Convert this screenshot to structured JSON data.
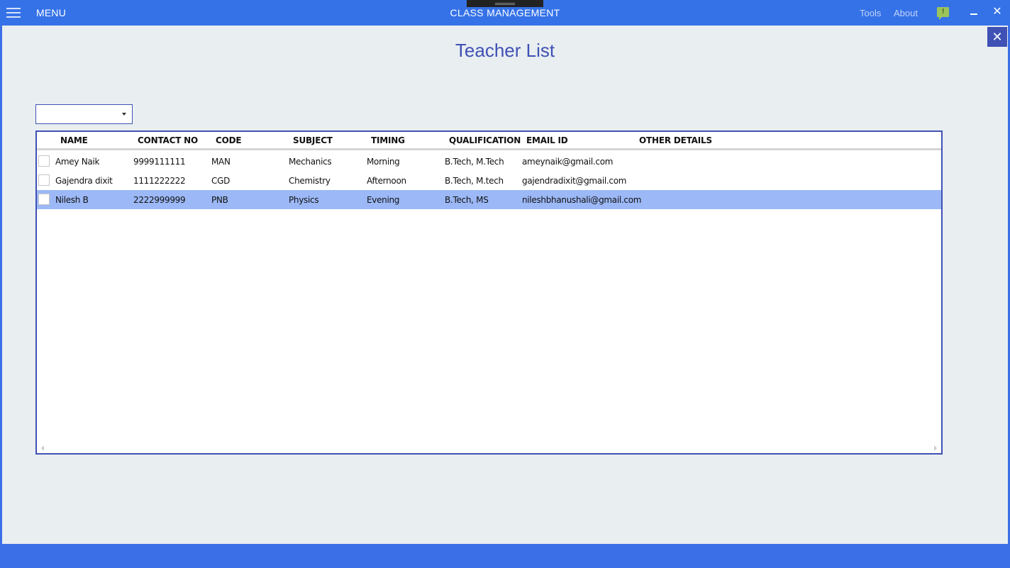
{
  "titlebar": {
    "menu_label": "MENU",
    "app_title": "CLASS MANAGEMENT",
    "tools_label": "Tools",
    "about_label": "About",
    "feedback_glyph": "!",
    "close_glyph": "✕",
    "accent_color": "#3572e8",
    "icons": [
      "hamburger-menu-icon",
      "feedback-icon",
      "minimize-icon",
      "close-icon"
    ]
  },
  "page": {
    "title": "Teacher List",
    "close_glyph": "✕",
    "title_color": "#3f51b5"
  },
  "filter": {
    "selected_value": ""
  },
  "grid": {
    "columns": [
      "NAME",
      "CONTACT NO",
      "CODE",
      "SUBJECT",
      "TIMING",
      "QUALIFICATION",
      "EMAIL ID",
      "OTHER DETAILS"
    ],
    "rows": [
      {
        "name": "Amey Naik",
        "contact": "9999111111",
        "code": "MAN",
        "subject": "Mechanics",
        "timing": "Morning",
        "qualification": "B.Tech, M.Tech",
        "email": "ameynaik@gmail.com",
        "other": "",
        "selected": false
      },
      {
        "name": "Gajendra dixit",
        "contact": "1111222222",
        "code": "CGD",
        "subject": "Chemistry",
        "timing": "Afternoon",
        "qualification": "B.Tech, M.tech",
        "email": "gajendradixit@gmail.com",
        "other": "",
        "selected": false
      },
      {
        "name": "Nilesh B",
        "contact": "2222999999",
        "code": "PNB",
        "subject": "Physics",
        "timing": "Evening",
        "qualification": "B.Tech, MS",
        "email": "nileshbhanushali@gmail.com",
        "other": "",
        "selected": true
      }
    ],
    "selected_color": "#9cb8f6"
  }
}
